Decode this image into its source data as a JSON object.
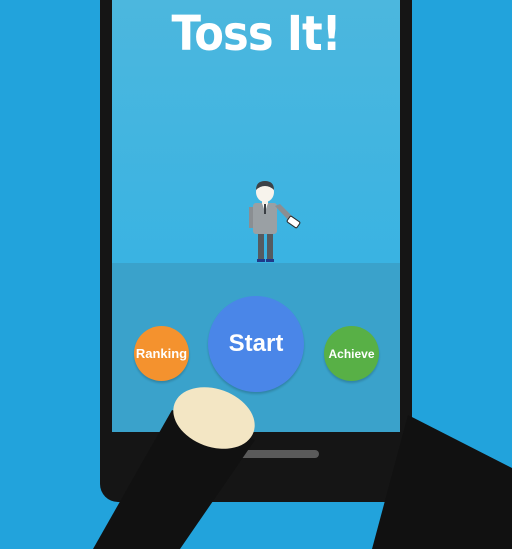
{
  "game": {
    "title": "Toss It!"
  },
  "menu": {
    "start_label": "Start",
    "ranking_label": "Ranking",
    "achieve_label": "Achieve"
  },
  "colors": {
    "background": "#22a3dc",
    "sky": "#3ab3e2",
    "ground": "#3aa2cb",
    "start_button": "#4a86e8",
    "ranking_button": "#f4922e",
    "achieve_button": "#58b046",
    "phone_body": "#151515"
  },
  "icons": {
    "character": "businessman-with-phone-icon",
    "finger": "pointing-finger-icon"
  }
}
